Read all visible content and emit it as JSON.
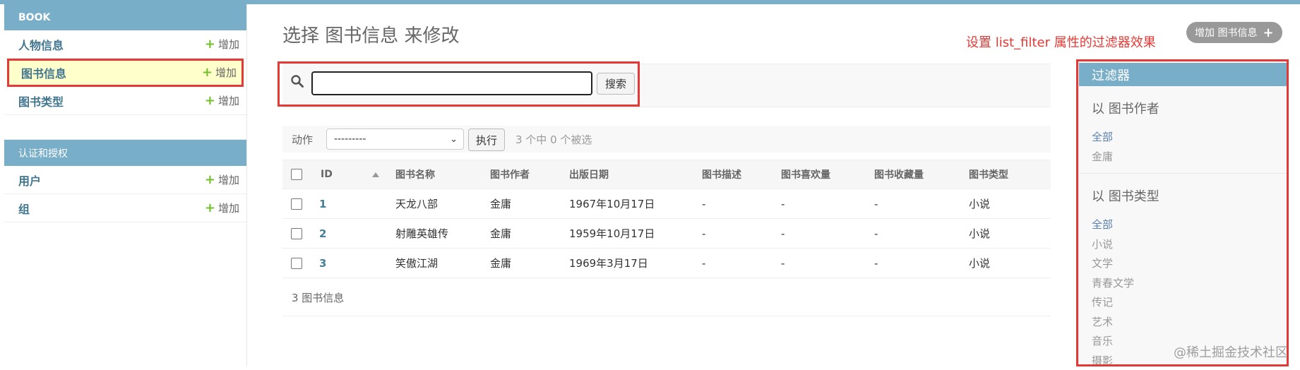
{
  "sidebar": {
    "book_module": {
      "title": "BOOK",
      "rows": [
        {
          "name": "人物信息",
          "add": "增加"
        },
        {
          "name": "图书信息",
          "add": "增加"
        },
        {
          "name": "图书类型",
          "add": "增加"
        }
      ]
    },
    "auth_module": {
      "title": "认证和授权",
      "rows": [
        {
          "name": "用户",
          "add": "增加"
        },
        {
          "name": "组",
          "add": "增加"
        }
      ]
    }
  },
  "main": {
    "title": "选择 图书信息 来修改",
    "note": "设置 list_filter 属性的过滤器效果",
    "add_button": "增加 图书信息",
    "search": {
      "value": "",
      "button": "搜索"
    },
    "actions": {
      "label": "动作",
      "selected": "---------",
      "run": "执行",
      "count": "3 个中 0 个被选"
    },
    "table": {
      "columns": [
        "ID",
        "图书名称",
        "图书作者",
        "出版日期",
        "图书描述",
        "图书喜欢量",
        "图书收藏量",
        "图书类型"
      ],
      "rows": [
        [
          "1",
          "天龙八部",
          "金庸",
          "1967年10月17日",
          "-",
          "-",
          "-",
          "小说"
        ],
        [
          "2",
          "射雕英雄传",
          "金庸",
          "1959年10月17日",
          "-",
          "-",
          "-",
          "小说"
        ],
        [
          "3",
          "笑傲江湖",
          "金庸",
          "1969年3月17日",
          "-",
          "-",
          "-",
          "小说"
        ]
      ]
    },
    "paginator": "3 图书信息"
  },
  "filter": {
    "title": "过滤器",
    "groups": [
      {
        "title": "以 图书作者",
        "options": [
          "全部",
          "金庸"
        ]
      },
      {
        "title": "以 图书类型",
        "options": [
          "全部",
          "小说",
          "文学",
          "青春文学",
          "传记",
          "艺术",
          "音乐",
          "摄影"
        ]
      }
    ]
  },
  "watermark": "@稀土掘金技术社区",
  "colors": {
    "accent": "#79aec8",
    "link": "#447e9b",
    "annotation_red": "#e53935",
    "add_green": "#70bf2b"
  }
}
